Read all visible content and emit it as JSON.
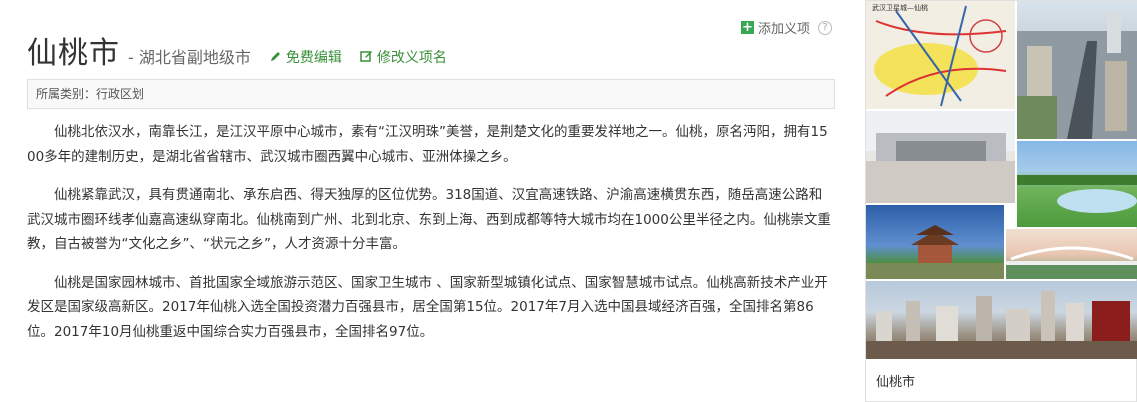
{
  "header": {
    "add_entry_label": "添加义项",
    "title": "仙桃市",
    "subtitle": "- 湖北省副地级市",
    "free_edit_label": "免费编辑",
    "modify_entry_label": "修改义项名"
  },
  "category": {
    "text": "所属类别：行政区划"
  },
  "content": {
    "paragraphs": [
      "仙桃北依汉水，南靠长江，是江汉平原中心城市，素有“江汉明珠”美誉，是荆楚文化的重要发祥地之一。仙桃，原名沔阳，拥有1500多年的建制历史，是湖北省省辖市、武汉城市圈西翼中心城市、亚洲体操之乡。",
      "仙桃紧靠武汉，具有贯通南北、承东启西、得天独厚的区位优势。318国道、汉宜高速铁路、沪渝高速横贯东西，随岳高速公路和武汉城市圈环线孝仙嘉高速纵穿南北。仙桃南到广州、北到北京、东到上海、西到成都等特大城市均在1000公里半径之内。仙桃崇文重教，自古被誉为“文化之乡”、“状元之乡”，人才资源十分丰富。",
      "仙桃是国家园林城市、首批国家全域旅游示范区、国家卫生城市 、国家新型城镇化试点、国家智慧城市试点。仙桃高新技术产业开发区是国家级高新区。2017年仙桃入选全国投资潜力百强县市，居全国第15位。2017年7月入选中国县域经济百强，全国排名第86位。2017年10月仙桃重返中国综合实力百强县市，全国排名97位。"
    ]
  },
  "album": {
    "caption": "仙桃市",
    "map_title": "武汉卫星城—仙桃"
  },
  "colors": {
    "link_green": "#3a8f3a",
    "plus_green": "#3aa757"
  },
  "icons": [
    "plus-icon",
    "help-icon",
    "pencil-icon",
    "edit-entry-icon"
  ]
}
